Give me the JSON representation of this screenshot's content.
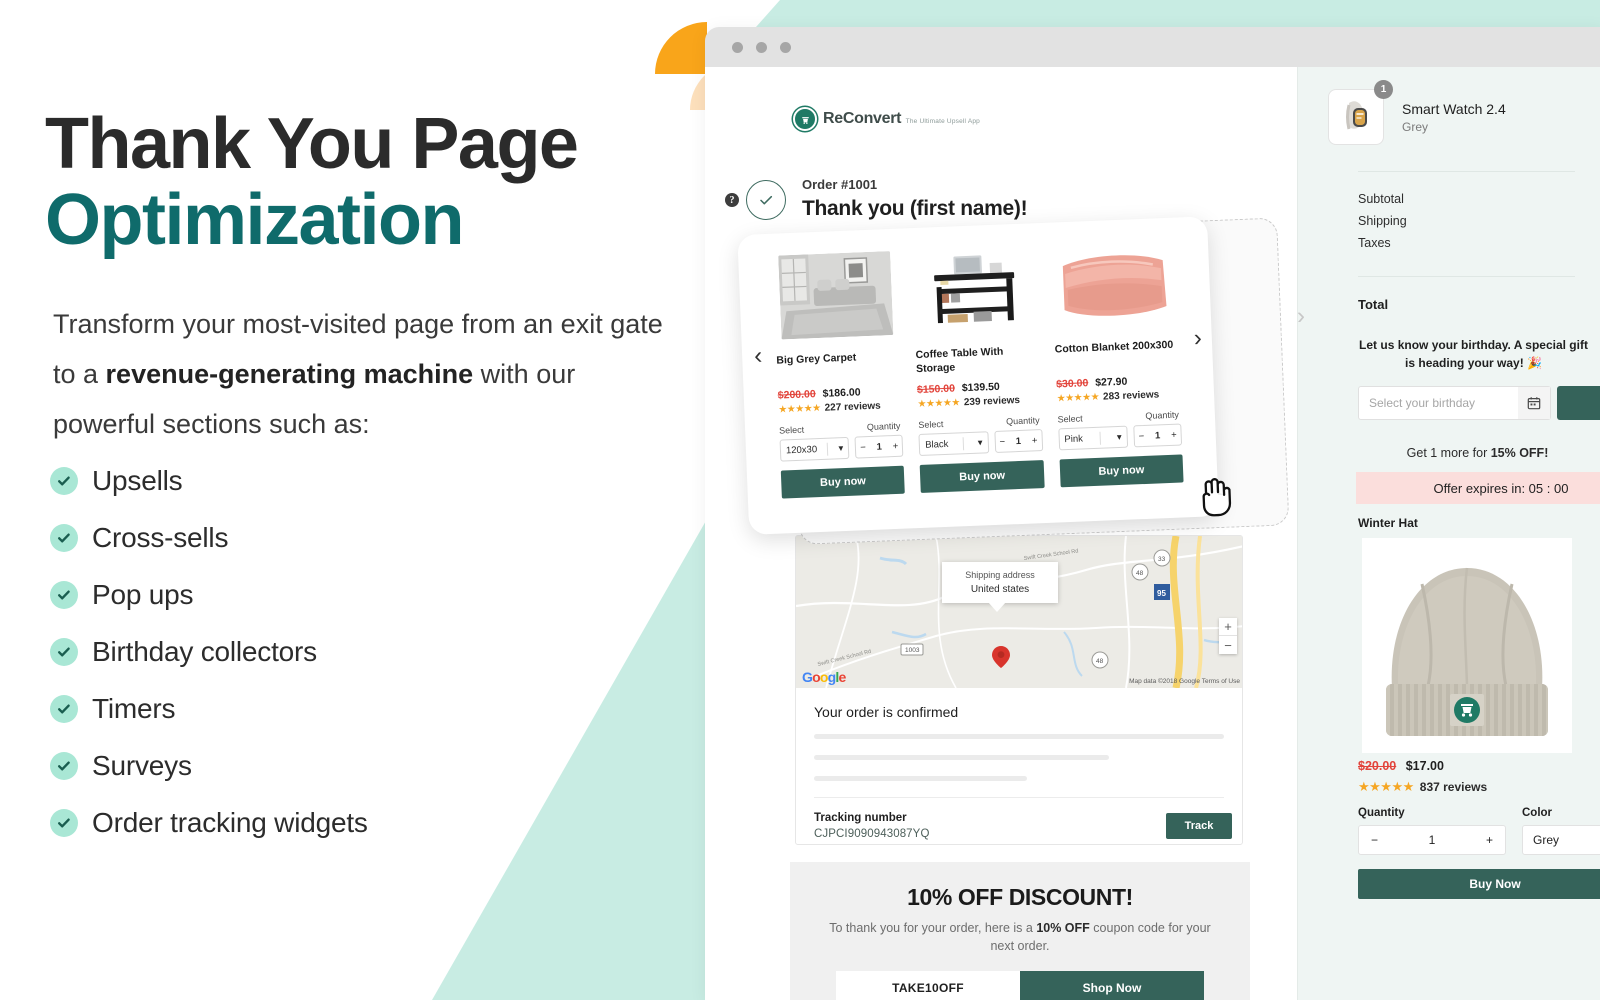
{
  "marketing": {
    "headline_line1": "Thank You Page",
    "headline_line2": "Optimization",
    "subcopy_part1": "Transform your most-visited page from an exit gate to a ",
    "subcopy_bold": "revenue-generating machine",
    "subcopy_part2": " with our powerful sections such as:",
    "features": [
      {
        "label": "Upsells"
      },
      {
        "label": "Cross-sells"
      },
      {
        "label": "Pop ups"
      },
      {
        "label": "Birthday collectors"
      },
      {
        "label": "Timers"
      },
      {
        "label": "Surveys"
      },
      {
        "label": "Order tracking widgets"
      }
    ],
    "colors": {
      "headline_dark": "#2b2b2b",
      "headline_teal": "#0f6b6b",
      "check_badge": "#a9e7d5",
      "bg_teal": "#c8ece3",
      "accent_orange": "#f9a51a",
      "accent_peach": "#fde0bc"
    }
  },
  "browser": {
    "brand": {
      "name": "ReConvert",
      "tagline": "The Ultimate Upsell App"
    },
    "order": {
      "help_icon": "question-mark-icon",
      "order_number": "Order #1001",
      "title": "Thank you (first name)!"
    },
    "carousel": {
      "prev_label": "‹",
      "next_label": "›",
      "products": [
        {
          "name": "Big Grey Carpet",
          "image": "grey-carpet-room-photo",
          "price_old": "$200.00",
          "price_new": "$186.00",
          "stars": "★★★★★",
          "reviews": "227 reviews",
          "select_label": "Select",
          "select_value": "120x30",
          "quantity_label": "Quantity",
          "quantity": "1",
          "buy_label": "Buy now"
        },
        {
          "name": "Coffee Table With Storage",
          "image": "black-coffee-table-photo",
          "price_old": "$150.00",
          "price_new": "$139.50",
          "stars": "★★★★★",
          "reviews": "239 reviews",
          "select_label": "Select",
          "select_value": "Black",
          "quantity_label": "Quantity",
          "quantity": "1",
          "buy_label": "Buy now"
        },
        {
          "name": "Cotton Blanket 200x300",
          "image": "pink-cotton-blanket-photo",
          "price_old": "$30.00",
          "price_new": "$27.90",
          "stars": "★★★★★",
          "reviews": "283 reviews",
          "select_label": "Select",
          "select_value": "Pink",
          "quantity_label": "Quantity",
          "quantity": "1",
          "buy_label": "Buy now"
        }
      ]
    },
    "map": {
      "bubble_line1": "Shipping address",
      "bubble_line2": "United states",
      "attribution": "Map data ©2018 Google    Terms of Use",
      "logo_letters": [
        "G",
        "o",
        "o",
        "g",
        "l",
        "e"
      ],
      "zoom_in": "+",
      "zoom_out": "−",
      "road_labels": [
        "Swift Creek School Rd",
        "Swift Creek School Rd",
        "1003",
        "33",
        "48",
        "48",
        "95"
      ]
    },
    "confirm": {
      "title": "Your order is confirmed",
      "tracking_label": "Tracking number",
      "tracking_code": "CJPCI9090943087YQ",
      "track_button": "Track"
    },
    "discount": {
      "title": "10% OFF DISCOUNT!",
      "sub_part1": "To thank you for your order, here is a ",
      "sub_bold": "10% OFF",
      "sub_part2": " coupon code for your next order.",
      "coupon_code": "TAKE10OFF",
      "shop_button": "Shop Now"
    }
  },
  "sidebar": {
    "cart_item": {
      "badge_count": "1",
      "image": "smart-watch-photo",
      "name": "Smart Watch 2.4",
      "variant": "Grey"
    },
    "totals": [
      {
        "label": "Subtotal"
      },
      {
        "label": "Shipping"
      },
      {
        "label": "Taxes"
      }
    ],
    "total_label": "Total",
    "birthday": {
      "message": "Let us know your birthday. A special gift is heading your way! 🎉",
      "placeholder": "Select your birthday",
      "calendar_icon": "calendar-icon"
    },
    "upsell": {
      "note_part1": "Get 1 more for ",
      "note_bold": "15% OFF!",
      "timer_text": "Offer expires in: 05 : 00",
      "product_label": "Winter Hat",
      "product_image": "grey-winter-beanie-photo",
      "price_old": "$20.00",
      "price_new": "$17.00",
      "stars": "★★★★★",
      "reviews": "837 reviews",
      "quantity_label": "Quantity",
      "quantity": "1",
      "color_label": "Color",
      "color_value": "Grey",
      "buy_label": "Buy Now"
    }
  }
}
